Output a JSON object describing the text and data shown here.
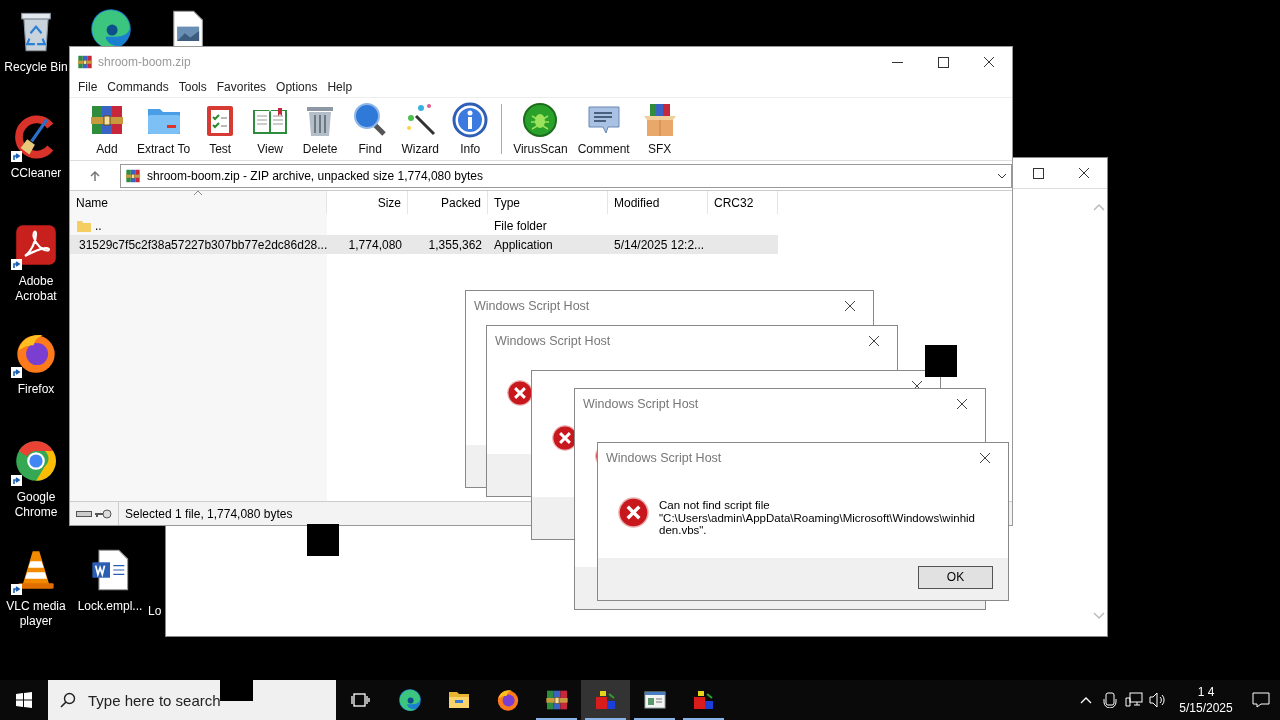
{
  "desktop": {
    "icons": [
      {
        "kind": "recycle-bin",
        "label": "Recycle Bin"
      },
      {
        "kind": "edge"
      },
      {
        "kind": "image-file"
      },
      {
        "kind": "ccleaner",
        "label": "CCleaner",
        "shortcut": true
      },
      {
        "kind": "acrobat",
        "label": "Adobe Acrobat",
        "shortcut": true
      },
      {
        "kind": "firefox",
        "label": "Firefox",
        "shortcut": true
      },
      {
        "kind": "chrome",
        "label": "Google Chrome",
        "shortcut": true
      },
      {
        "kind": "vlc",
        "label": "VLC media player",
        "shortcut": true
      },
      {
        "kind": "word-file",
        "label": "Lock.empl..."
      },
      {
        "kind": "hidden",
        "label": "Lo"
      }
    ]
  },
  "archiver": {
    "title": "shroom-boom.zip",
    "menu": [
      "File",
      "Commands",
      "Tools",
      "Favorites",
      "Options",
      "Help"
    ],
    "toolbar": [
      {
        "buttons": [
          {
            "kind": "add",
            "label": "Add"
          },
          {
            "kind": "extract",
            "label": "Extract To"
          },
          {
            "kind": "test",
            "label": "Test"
          },
          {
            "kind": "view",
            "label": "View"
          },
          {
            "kind": "delete",
            "label": "Delete"
          },
          {
            "kind": "find",
            "label": "Find"
          },
          {
            "kind": "wizard",
            "label": "Wizard"
          },
          {
            "kind": "info",
            "label": "Info"
          }
        ]
      },
      {
        "buttons": [
          {
            "kind": "virusscan",
            "label": "VirusScan"
          },
          {
            "kind": "comment",
            "label": "Comment"
          },
          {
            "kind": "sfx",
            "label": "SFX"
          }
        ]
      }
    ],
    "address": "shroom-boom.zip - ZIP archive, unpacked size 1,774,080 bytes",
    "columns": [
      {
        "label": "Name",
        "sorted": true
      },
      {
        "label": "Size",
        "sorted": false
      },
      {
        "label": "Packed",
        "sorted": false
      },
      {
        "label": "Type",
        "sorted": false
      },
      {
        "label": "Modified",
        "sorted": false
      },
      {
        "label": "CRC32",
        "sorted": false
      }
    ],
    "rows": [
      {
        "kind": "folder",
        "cells": [
          "..",
          "",
          "",
          "File folder",
          "",
          ""
        ],
        "selected": false
      },
      {
        "kind": "app",
        "cells": [
          "31529c7f5c2f38a57227b307bb77e2dc86d28...",
          "1,774,080",
          "1,355,362",
          "Application",
          "5/14/2025 12:2...",
          ""
        ],
        "selected": true
      }
    ],
    "status": "Selected 1 file, 1,774,080 bytes"
  },
  "dialogs": [
    {
      "kind": "error",
      "title": "Windows Script Host"
    },
    {
      "kind": "error",
      "title": "Windows Script Host"
    },
    {
      "kind": "error"
    },
    {
      "kind": "error",
      "title": "Windows Script Host"
    },
    {
      "kind": "error",
      "title": "Windows Script Host",
      "message": "Can not find script file \"C:\\Users\\admin\\AppData\\Roaming\\Microsoft\\Windows\\winhidden.vbs\".",
      "button": "OK"
    }
  ],
  "taskbar": {
    "search_placeholder": "Type here to search",
    "apps": [
      {
        "kind": "edge",
        "selected": false,
        "running": false
      },
      {
        "kind": "explorer",
        "selected": false,
        "running": false
      },
      {
        "kind": "firefox",
        "selected": false,
        "running": false
      },
      {
        "kind": "winrar",
        "selected": false,
        "running": true
      },
      {
        "kind": "blocks",
        "selected": true,
        "running": true
      },
      {
        "kind": "window",
        "selected": false,
        "running": true
      },
      {
        "kind": "blocks",
        "selected": false,
        "running": true
      }
    ],
    "time": "1 4",
    "date": "5/15/2025"
  }
}
